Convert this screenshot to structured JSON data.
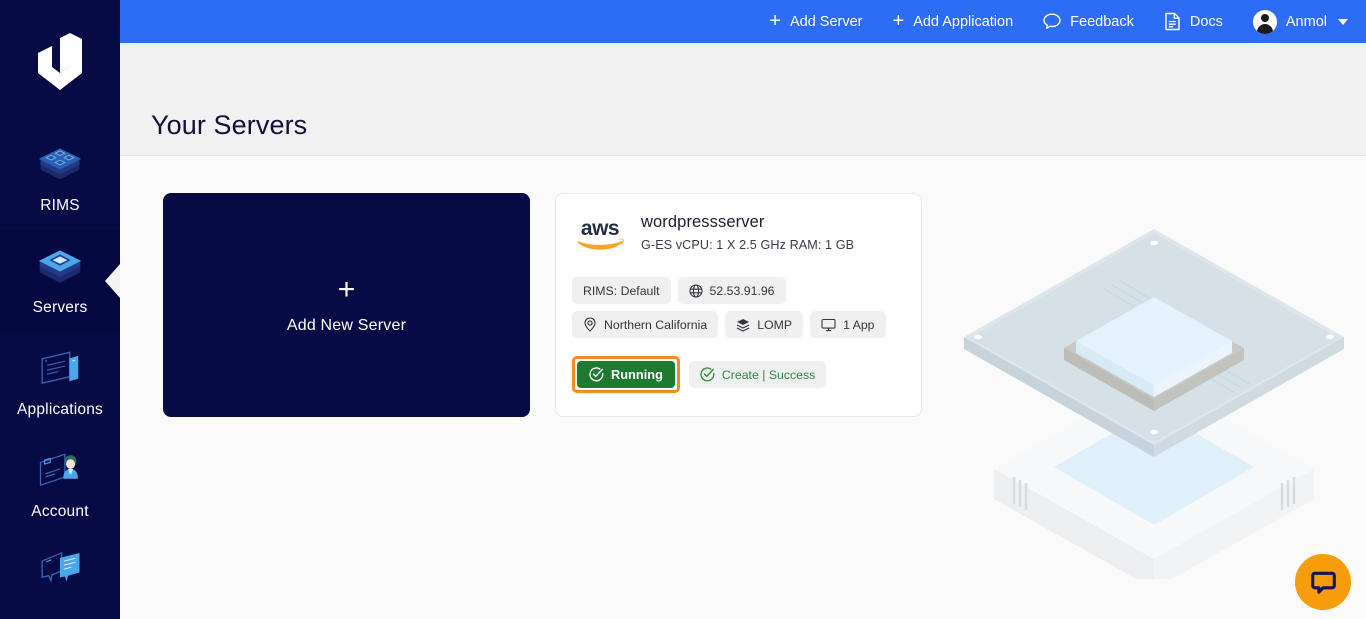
{
  "brand": {
    "logo_icon": "devrims-shield-logo",
    "primary_blue": "#2d6df6",
    "sidebar_navy": "#060b46",
    "accent_orange": "#f79c0c"
  },
  "sidebar": {
    "items": [
      {
        "label": "RIMS",
        "icon": "rims-stack-icon",
        "active": false
      },
      {
        "label": "Servers",
        "icon": "server-stack-icon",
        "active": true
      },
      {
        "label": "Applications",
        "icon": "applications-window-icon",
        "active": false
      },
      {
        "label": "Account",
        "icon": "account-user-card-icon",
        "active": false
      },
      {
        "label": "",
        "icon": "support-chat-icon",
        "active": false
      }
    ]
  },
  "topbar": {
    "items": [
      {
        "label": "Add Server",
        "icon": "plus-icon"
      },
      {
        "label": "Add Application",
        "icon": "plus-icon"
      },
      {
        "label": "Feedback",
        "icon": "chat-bubble-icon"
      },
      {
        "label": "Docs",
        "icon": "document-icon"
      }
    ],
    "user": {
      "name": "Anmol",
      "avatar_icon": "user-avatar-icon",
      "caret_icon": "chevron-down-icon"
    }
  },
  "header": {
    "title": "Your Servers"
  },
  "add_card": {
    "plus": "+",
    "label": "Add New Server"
  },
  "server": {
    "provider_logo": "aws-logo",
    "name": "wordpressserver",
    "specs": "G-ES  vCPU: 1 X 2.5 GHz  RAM: 1 GB",
    "tags": [
      {
        "label": "RIMS: Default",
        "icon": "none"
      },
      {
        "label": "52.53.91.96",
        "icon": "globe-icon"
      },
      {
        "label": "Northern California",
        "icon": "location-pin-icon"
      },
      {
        "label": "LOMP",
        "icon": "stack-layers-icon"
      },
      {
        "label": "1 App",
        "icon": "monitor-icon"
      }
    ],
    "status": {
      "running_label": "Running",
      "running_icon": "check-circle-icon",
      "running_highlighted": true,
      "create_label": "Create | Success",
      "create_icon": "check-circle-icon"
    }
  },
  "chat_fab": {
    "icon": "chat-bubble-icon"
  }
}
